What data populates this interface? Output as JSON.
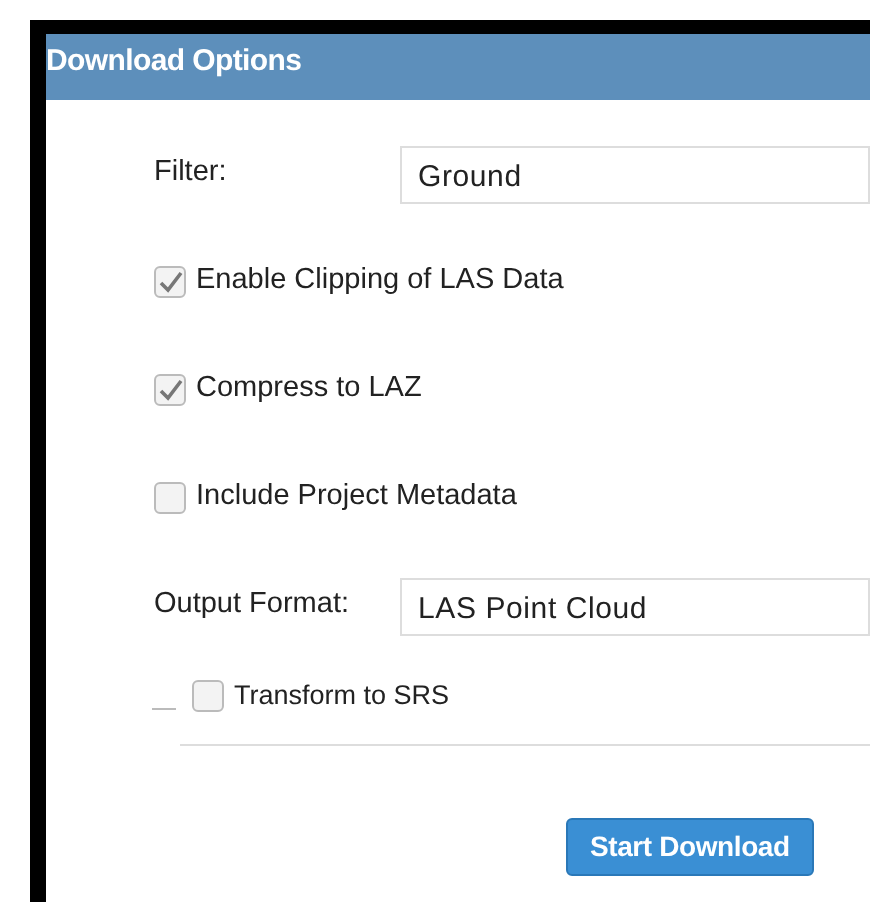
{
  "window": {
    "title": "Download Options"
  },
  "rows": [
    {
      "kind": "select",
      "label": "Filter:",
      "value": "Ground"
    },
    {
      "kind": "checkbox",
      "label": "Enable Clipping of LAS Data",
      "checked": true
    },
    {
      "kind": "checkbox",
      "label": "Compress to LAZ",
      "checked": true
    },
    {
      "kind": "checkbox",
      "label": "Include Project Metadata",
      "checked": false
    },
    {
      "kind": "select",
      "label": "Output Format:",
      "value": "LAS Point Cloud"
    },
    {
      "kind": "legend-checkbox",
      "label": "Transform to SRS",
      "checked": false
    }
  ],
  "buttons": [
    "Start Download"
  ]
}
